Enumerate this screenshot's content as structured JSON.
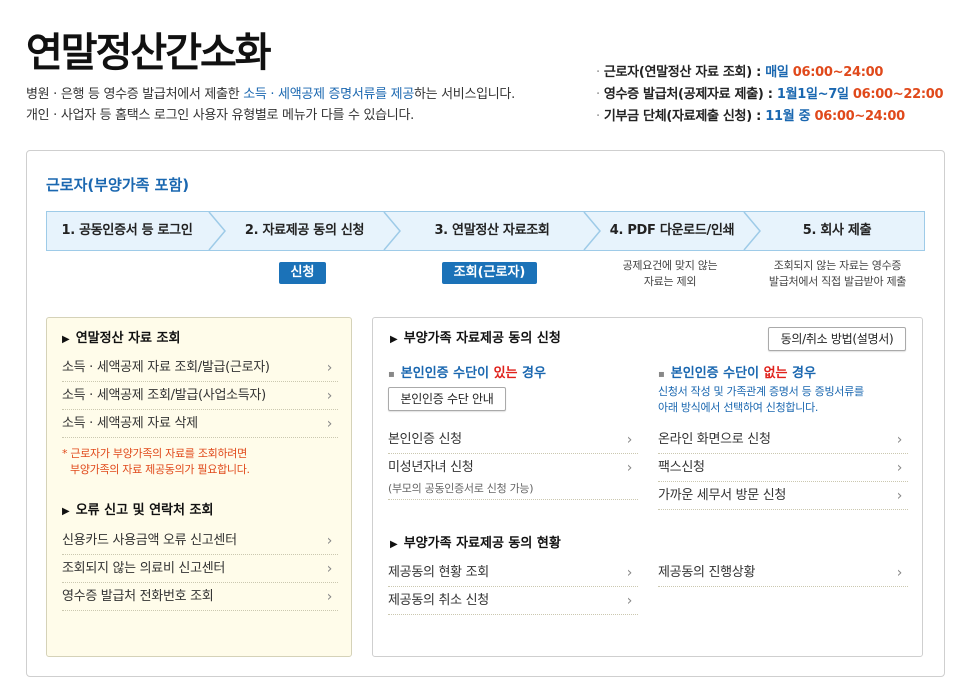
{
  "page": {
    "title": "연말정산간소화",
    "intro_line1_pre": "병원 · 은행 등 영수증 발급처에서 제출한 ",
    "intro_line1_hl": "소득 · 세액공제 증명서류를 제공",
    "intro_line1_post": "하는 서비스입니다.",
    "intro_line2": "개인 · 사업자 등 홈택스 로그인 사용자 유형별로 메뉴가 다를 수 있습니다."
  },
  "schedule": [
    {
      "label": "근로자(연말정산 자료 조회) : ",
      "blue": "매일 ",
      "orange": "06:00~24:00"
    },
    {
      "label": "영수증 발급처(공제자료 제출) : ",
      "blue": "1월1일~7일 ",
      "orange": "06:00~22:00"
    },
    {
      "label": "기부금 단체(자료제출 신청) : ",
      "blue": "11월 중 ",
      "orange": "06:00~24:00"
    }
  ],
  "section_title": "근로자(부양가족 포함)",
  "steps": [
    {
      "label": "1. 공동인증서 등 로그인"
    },
    {
      "label": "2. 자료제공 동의 신청"
    },
    {
      "label": "3. 연말정산 자료조회"
    },
    {
      "label": "4. PDF 다운로드/인쇄"
    },
    {
      "label": "5. 회사 제출"
    }
  ],
  "step_actions": {
    "apply_button": "신청",
    "inquiry_button": "조회(근로자)",
    "note4_line1": "공제요건에 맞지 않는",
    "note4_line2": "자료는 제외",
    "note5_line1": "조회되지 않는 자료는 영수증",
    "note5_line2": "발급처에서 직접 발급받아 제출"
  },
  "left_panel": {
    "head1": "연말정산 자료 조회",
    "links1": [
      "소득 · 세액공제 자료 조회/발급(근로자)",
      "소득 · 세액공제 조회/발급(사업소득자)",
      "소득 · 세액공제 자료 삭제"
    ],
    "warn_line1": "* 근로자가 부양가족의 자료를 조회하려면",
    "warn_line2": "부양가족의 자료 제공동의가 필요합니다.",
    "head2": "오류 신고 및 연락처 조회",
    "links2": [
      "신용카드 사용금액 오류 신고센터",
      "조회되지 않는 의료비 신고센터",
      "영수증 발급처 전화번호 조회"
    ]
  },
  "right_panel": {
    "head1": "부양가족 자료제공 동의 신청",
    "method_button": "동의/취소 방법(설명서)",
    "with_auth_pre": "본인인증 수단이 ",
    "with_auth_red": "있는",
    "with_auth_post": " 경우",
    "auth_guide_button": "본인인증 수단 안내",
    "without_auth_pre": "본인인증 수단이 ",
    "without_auth_red": "없는",
    "without_auth_post": " 경우",
    "without_note_line1": "신청서 작성 및 가족관계 증명서 등 증빙서류를",
    "without_note_line2": "아래 방식에서 선택하여 신청합니다.",
    "left_links": [
      "본인인증 신청",
      "미성년자녀 신청"
    ],
    "minor_note": "(부모의 공동인증서로 신청 가능)",
    "right_links": [
      "온라인 화면으로 신청",
      "팩스신청",
      "가까운 세무서 방문 신청"
    ],
    "head2": "부양가족 자료제공 동의 현황",
    "status_left": [
      "제공동의 현황 조회",
      "제공동의 취소 신청"
    ],
    "status_right": [
      "제공동의 진행상황"
    ]
  },
  "icons": {
    "bullet": "triangle-right-icon",
    "chevron": "chevron-right-icon",
    "dot": "square-bullet-icon"
  },
  "colors": {
    "blue": "#1a67b0",
    "orange": "#e0491b",
    "red": "#e0211b",
    "step_bg": "#e7f3fc",
    "left_bg": "#fffcea",
    "button_blue": "#1b72b8"
  }
}
